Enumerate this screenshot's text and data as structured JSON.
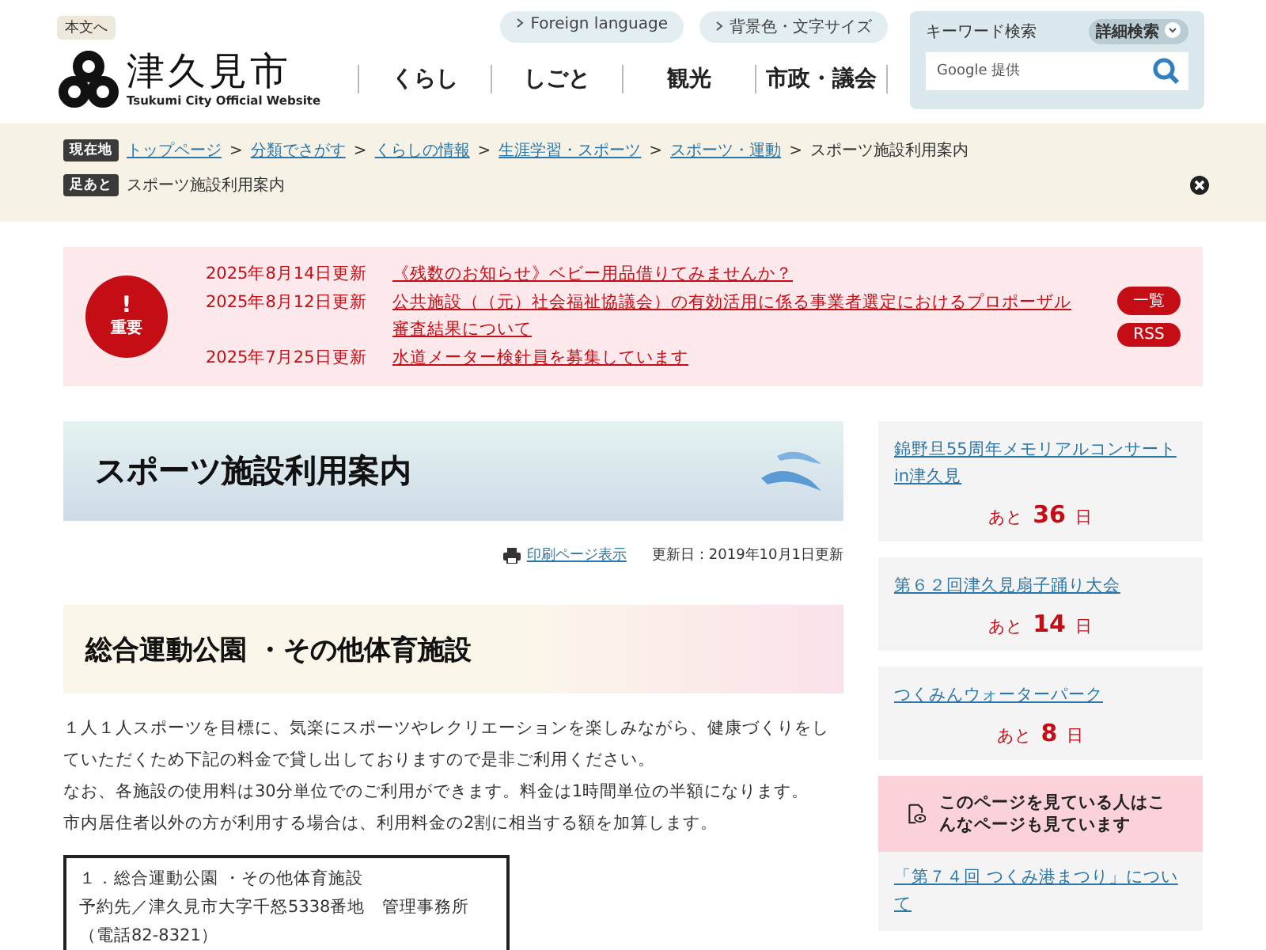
{
  "header": {
    "skip_link": "本文へ",
    "site_name": "津久見市",
    "site_subtitle": "Tsukumi City Official Website",
    "utility_links": [
      "Foreign language",
      "背景色・文字サイズ"
    ],
    "nav": [
      "くらし",
      "しごと",
      "観光",
      "市政・議会"
    ],
    "search": {
      "label": "キーワード検索",
      "advanced": "詳細検索",
      "placeholder": "Google 提供"
    }
  },
  "breadcrumb": {
    "label": "現在地",
    "links": [
      "トップページ",
      "分類でさがす",
      "くらしの情報",
      "生涯学習・スポーツ",
      "スポーツ・運動"
    ],
    "separator": ">",
    "current": "スポーツ施設利用案内"
  },
  "footprint": {
    "label": "足あと",
    "items": [
      "スポーツ施設利用案内"
    ]
  },
  "notice": {
    "badge_mark": "!",
    "badge_label": "重要",
    "items": [
      {
        "date": "2025年8月14日更新",
        "title": "《残数のお知らせ》ベビー用品借りてみませんか？"
      },
      {
        "date": "2025年8月12日更新",
        "title": "公共施設（（元）社会福祉協議会）の有効活用に係る事業者選定におけるプロポーザル審査結果について"
      },
      {
        "date": "2025年7月25日更新",
        "title": "水道メーター検針員を募集しています"
      }
    ],
    "buttons": [
      "一覧",
      "RSS"
    ]
  },
  "page": {
    "title": "スポーツ施設利用案内",
    "print_link": "印刷ページ表示",
    "updated": "更新日：2019年10月1日更新",
    "section_title": "総合運動公園 ・その他体育施設",
    "paragraphs": [
      "１人１人スポーツを目標に、気楽にスポーツやレクリエーションを楽しみながら、健康づくりをしていただくため下記の料金で貸し出しておりますので是非ご利用ください。",
      "なお、各施設の使用料は30分単位でのご利用ができます。料金は1時間単位の半額になります。",
      "市内居住者以外の方が利用する場合は、利用料金の2割に相当する額を加算します。"
    ],
    "info_box": [
      "１．総合運動公園 ・その他体育施設",
      "予約先／津久見市大字千怒5338番地　管理事務所（電話82-8321）"
    ]
  },
  "sidebar": {
    "events": [
      {
        "title": "錦野旦55周年メモリアルコンサートin津久見",
        "prefix": "あと",
        "days": "36",
        "unit": "日"
      },
      {
        "title": "第６２回津久見扇子踊り大会",
        "prefix": "あと",
        "days": "14",
        "unit": "日"
      },
      {
        "title": "つくみんウォーターパーク",
        "prefix": "あと",
        "days": "8",
        "unit": "日"
      }
    ],
    "related": {
      "heading": "このページを見ている人はこんなページも見ています",
      "links": [
        "「第７４回 つくみ港まつり」について"
      ]
    }
  }
}
